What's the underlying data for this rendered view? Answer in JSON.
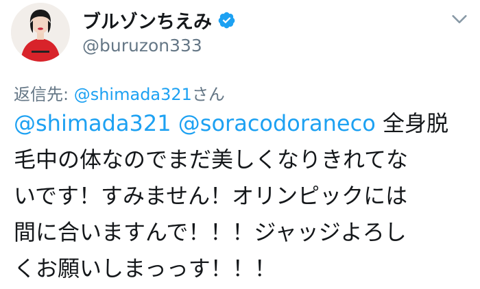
{
  "user": {
    "display_name": "ブルゾンちえみ",
    "handle": "@buruzon333",
    "verified": true,
    "avatar_icon": "user-avatar"
  },
  "header": {
    "menu_icon": "chevron-down-icon"
  },
  "reply": {
    "prefix": "返信先: ",
    "mention": "@shimada321",
    "suffix": "さん"
  },
  "tweet": {
    "mention_1": "@shimada321",
    "mention_2": "@soracodoraneco",
    "line1_rest": " 全身脱",
    "line2": "毛中の体なのでまだ美しくなりきれてな",
    "line3": "いです！すみません！オリンピックには",
    "line4": "間に合いますんで！！！ジャッジよろし",
    "line5": "くお願いしまっっす！！！"
  },
  "colors": {
    "link": "#1da1f2",
    "secondary": "#657786",
    "text": "#14171a",
    "verified": "#1da1f2"
  }
}
